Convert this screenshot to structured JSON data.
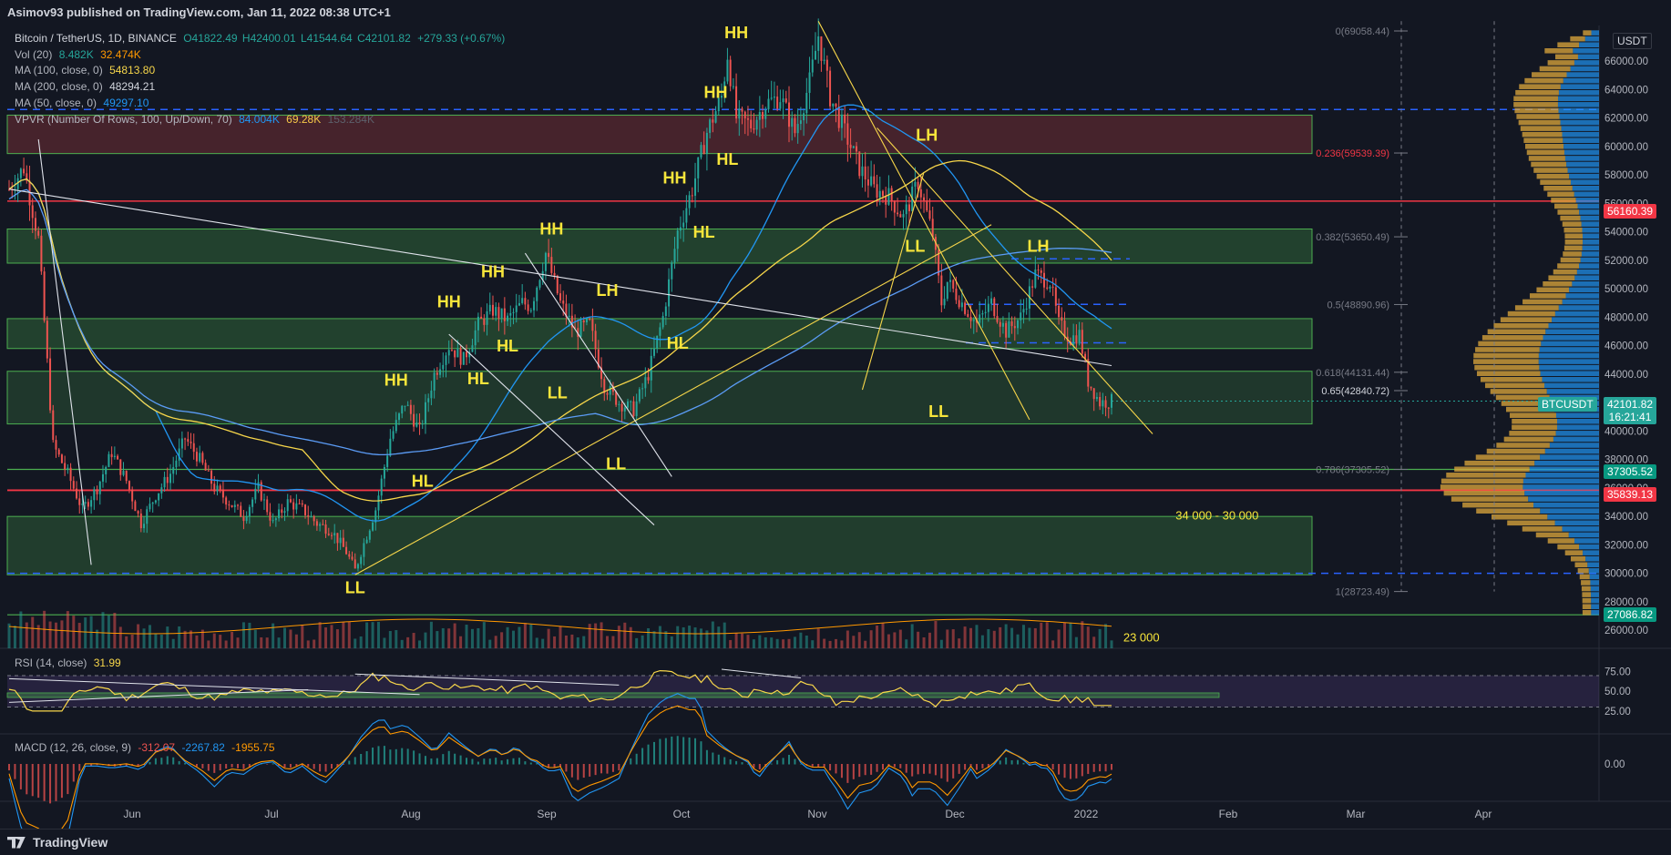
{
  "byline": "Asimov93 published on TradingView.com, Jan 11, 2022 08:38 UTC+1",
  "legend": {
    "symbol": "Bitcoin / TetherUS, 1D, BINANCE",
    "ohlc": {
      "o": "O41822.49",
      "h": "H42400.01",
      "l": "L41544.64",
      "c": "C42101.82",
      "chg": "+279.33 (+0.67%)"
    },
    "vol": {
      "label": "Vol (20)",
      "v1": "8.482K",
      "v2": "32.474K"
    },
    "ma100": {
      "label": "MA (100, close, 0)",
      "value": "54813.80"
    },
    "ma200": {
      "label": "MA (200, close, 0)",
      "value": "48294.21"
    },
    "ma50": {
      "label": "MA (50, close, 0)",
      "value": "49297.10"
    },
    "vpvr": {
      "label": "VPVR (Number Of Rows, 100, Up/Down, 70)",
      "v1": "84.004K",
      "v2": "69.28K",
      "v3": "153.284K"
    }
  },
  "rsi_label": {
    "label": "RSI (14, close)",
    "value": "31.99"
  },
  "macd_label": {
    "label": "MACD (12, 26, close, 9)",
    "v1": "-312.07",
    "v2": "-2267.82",
    "v3": "-1955.75"
  },
  "currency_badge": "USDT",
  "price_badges": {
    "btcusdt": {
      "name": "BTCUSDT",
      "price": "42101.82",
      "time": "16:21:41",
      "bg": "#26a69a"
    },
    "r1": {
      "text": "56160.39",
      "bg": "#f23645"
    },
    "g1": {
      "text": "37305.52",
      "bg": "#089981"
    },
    "r2": {
      "text": "35839.13",
      "bg": "#f23645"
    },
    "g2": {
      "text": "27086.82",
      "bg": "#089981"
    }
  },
  "footer_logo": "TradingView",
  "chart_data": {
    "type": "candlestick",
    "title": "Bitcoin / TetherUS, 1D, BINANCE",
    "x_ticks": [
      "Jun",
      "Jul",
      "Aug",
      "Sep",
      "Oct",
      "Nov",
      "Dec",
      "2022",
      "Feb",
      "Mar",
      "Apr"
    ],
    "y_ticks": [
      66000,
      64000,
      62000,
      60000,
      58000,
      56000,
      54000,
      52000,
      50000,
      48000,
      46000,
      44000,
      42000,
      40000,
      38000,
      36000,
      34000,
      32000,
      30000,
      28000,
      26000
    ],
    "y_tick_labels": [
      "66000.00",
      "64000.00",
      "62000.00",
      "60000.00",
      "58000.00",
      "56000.00",
      "54000.00",
      "52000.00",
      "50000.00",
      "48000.00",
      "46000.00",
      "44000.00",
      "42000.00",
      "40000.00",
      "38000.00",
      "36000.00",
      "34000.00",
      "32000.00",
      "30000.00",
      "28000.00",
      "26000.00"
    ],
    "ylim": [
      25500,
      68500
    ],
    "close_path": [
      [
        0,
        57000
      ],
      [
        5,
        58500
      ],
      [
        10,
        53500
      ],
      [
        15,
        39000
      ],
      [
        20,
        37000
      ],
      [
        25,
        34500
      ],
      [
        30,
        36000
      ],
      [
        35,
        38500
      ],
      [
        40,
        36500
      ],
      [
        45,
        33500
      ],
      [
        50,
        35500
      ],
      [
        55,
        37000
      ],
      [
        60,
        39500
      ],
      [
        65,
        38000
      ],
      [
        70,
        36000
      ],
      [
        75,
        35000
      ],
      [
        80,
        34000
      ],
      [
        85,
        36000
      ],
      [
        90,
        33500
      ],
      [
        95,
        35000
      ],
      [
        100,
        34500
      ],
      [
        105,
        33500
      ],
      [
        110,
        33000
      ],
      [
        115,
        31500
      ],
      [
        118,
        30200
      ],
      [
        120,
        31500
      ],
      [
        125,
        34500
      ],
      [
        130,
        39500
      ],
      [
        135,
        42000
      ],
      [
        140,
        40000
      ],
      [
        145,
        44000
      ],
      [
        150,
        46000
      ],
      [
        155,
        45000
      ],
      [
        160,
        47500
      ],
      [
        165,
        48500
      ],
      [
        170,
        47800
      ],
      [
        175,
        49000
      ],
      [
        178,
        48800
      ],
      [
        183,
        52500
      ],
      [
        188,
        49000
      ],
      [
        193,
        47000
      ],
      [
        198,
        47500
      ],
      [
        203,
        43200
      ],
      [
        208,
        42000
      ],
      [
        213,
        41500
      ],
      [
        218,
        44000
      ],
      [
        223,
        48000
      ],
      [
        228,
        54000
      ],
      [
        233,
        57000
      ],
      [
        238,
        61000
      ],
      [
        243,
        63500
      ],
      [
        245,
        66500
      ],
      [
        248,
        62000
      ],
      [
        253,
        61500
      ],
      [
        258,
        63000
      ],
      [
        263,
        63500
      ],
      [
        268,
        61000
      ],
      [
        273,
        64500
      ],
      [
        276,
        67800
      ],
      [
        280,
        63500
      ],
      [
        285,
        61000
      ],
      [
        290,
        58500
      ],
      [
        295,
        57000
      ],
      [
        300,
        56500
      ],
      [
        305,
        55000
      ],
      [
        310,
        57500
      ],
      [
        315,
        53800
      ],
      [
        318,
        49000
      ],
      [
        320,
        50500
      ],
      [
        325,
        49000
      ],
      [
        330,
        47500
      ],
      [
        335,
        49000
      ],
      [
        340,
        47000
      ],
      [
        345,
        48000
      ],
      [
        350,
        51000
      ],
      [
        355,
        50500
      ],
      [
        358,
        47500
      ],
      [
        362,
        46500
      ],
      [
        365,
        46800
      ],
      [
        368,
        43500
      ],
      [
        372,
        42000
      ],
      [
        376,
        42100
      ]
    ],
    "annotations": [
      {
        "text": "HH",
        "x": 248,
        "y": 67600
      },
      {
        "text": "HH",
        "x": 241,
        "y": 63400
      },
      {
        "text": "HL",
        "x": 245,
        "y": 58700
      },
      {
        "text": "HH",
        "x": 227,
        "y": 57400
      },
      {
        "text": "HL",
        "x": 237,
        "y": 53600
      },
      {
        "text": "HH",
        "x": 185,
        "y": 53800
      },
      {
        "text": "HH",
        "x": 165,
        "y": 50800
      },
      {
        "text": "HH",
        "x": 150,
        "y": 48700
      },
      {
        "text": "HL",
        "x": 170,
        "y": 45600
      },
      {
        "text": "HL",
        "x": 160,
        "y": 43300
      },
      {
        "text": "LH",
        "x": 204,
        "y": 49500
      },
      {
        "text": "HL",
        "x": 228,
        "y": 45800
      },
      {
        "text": "LL",
        "x": 187,
        "y": 42300
      },
      {
        "text": "LL",
        "x": 207,
        "y": 37300
      },
      {
        "text": "HH",
        "x": 132,
        "y": 43200
      },
      {
        "text": "HL",
        "x": 141,
        "y": 36100
      },
      {
        "text": "LL",
        "x": 118,
        "y": 28600
      },
      {
        "text": "LH",
        "x": 313,
        "y": 60400
      },
      {
        "text": "LL",
        "x": 309,
        "y": 52600
      },
      {
        "text": "LH",
        "x": 351,
        "y": 52600
      },
      {
        "text": "LL",
        "x": 317,
        "y": 41000
      }
    ],
    "zone_label": {
      "text": "34 000 - 30 000",
      "x": 412,
      "y": 33800
    },
    "fib_levels": [
      {
        "label": "0(69058.44)",
        "value": 69058.44
      },
      {
        "label": "0.236(59539.39)",
        "value": 59539.39
      },
      {
        "label": "0.382(53650.49)",
        "value": 53650.49
      },
      {
        "label": "0.5(48890.96)",
        "value": 48890.96
      },
      {
        "label": "0.618(44131.44)",
        "value": 44131.44
      },
      {
        "label": "0.65(42840.72)",
        "value": 42840.72
      },
      {
        "label": "0.786(37305.52)",
        "value": 37305.52
      },
      {
        "label": "1(28723.49)",
        "value": 28723.49
      }
    ],
    "partial_label": {
      "text": "23 000",
      "x": 380,
      "y": 25200
    },
    "rsi": {
      "y_ticks": [
        75,
        50,
        25
      ],
      "y_tick_labels": [
        "75.00",
        "50.00",
        "25.00"
      ],
      "overbought": 70,
      "oversold": 30,
      "last": 31.99
    },
    "macd": {
      "y_ticks": [
        0
      ],
      "y_tick_labels": [
        "0.00"
      ]
    }
  }
}
